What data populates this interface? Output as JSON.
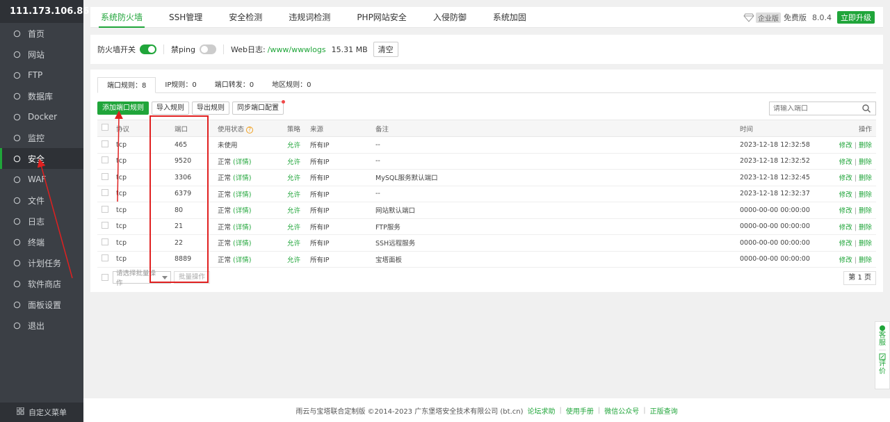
{
  "sidebar": {
    "ip": "111.173.106.86",
    "badge": "0",
    "items": [
      {
        "label": "首页"
      },
      {
        "label": "网站"
      },
      {
        "label": "FTP"
      },
      {
        "label": "数据库"
      },
      {
        "label": "Docker"
      },
      {
        "label": "监控"
      },
      {
        "label": "安全"
      },
      {
        "label": "WAF"
      },
      {
        "label": "文件"
      },
      {
        "label": "日志"
      },
      {
        "label": "终端"
      },
      {
        "label": "计划任务"
      },
      {
        "label": "软件商店"
      },
      {
        "label": "面板设置"
      },
      {
        "label": "退出"
      }
    ],
    "footer": "自定义菜单"
  },
  "topbar": {
    "tabs": [
      "系统防火墙",
      "SSH管理",
      "安全检测",
      "违规词检测",
      "PHP网站安全",
      "入侵防御",
      "系统加固"
    ],
    "edition": "企业版",
    "free": "免费版",
    "version": "8.0.4",
    "upgrade": "立即升级"
  },
  "firewall": {
    "switch_label": "防火墙开关",
    "ping_label": "禁ping",
    "weblog_label": "Web日志:",
    "weblog_path": "/www/wwwlogs",
    "weblog_size": "15.31 MB",
    "clear": "清空"
  },
  "subtabs": [
    "端口规则：8",
    "IP规则：0",
    "端口转发：0",
    "地区规则：0"
  ],
  "actions": {
    "add": "添加端口规则",
    "import": "导入规则",
    "export": "导出规则",
    "sync": "同步端口配置"
  },
  "search": {
    "placeholder": "请输入端口"
  },
  "table": {
    "headers": {
      "proto": "协议",
      "port": "端口",
      "status": "使用状态",
      "policy": "策略",
      "source": "来源",
      "note": "备注",
      "time": "时间",
      "op": "操作"
    },
    "rows": [
      {
        "proto": "tcp",
        "port": "465",
        "status": "未使用",
        "detail": "",
        "policy": "允许",
        "source": "所有IP",
        "note": "--",
        "time": "2023-12-18 12:32:58"
      },
      {
        "proto": "tcp",
        "port": "9520",
        "status": "正常",
        "detail": "(详情)",
        "policy": "允许",
        "source": "所有IP",
        "note": "--",
        "time": "2023-12-18 12:32:52"
      },
      {
        "proto": "tcp",
        "port": "3306",
        "status": "正常",
        "detail": "(详情)",
        "policy": "允许",
        "source": "所有IP",
        "note": "MySQL服务默认端口",
        "time": "2023-12-18 12:32:45"
      },
      {
        "proto": "tcp",
        "port": "6379",
        "status": "正常",
        "detail": "(详情)",
        "policy": "允许",
        "source": "所有IP",
        "note": "--",
        "time": "2023-12-18 12:32:37"
      },
      {
        "proto": "tcp",
        "port": "80",
        "status": "正常",
        "detail": "(详情)",
        "policy": "允许",
        "source": "所有IP",
        "note": "网站默认端口",
        "time": "0000-00-00 00:00:00"
      },
      {
        "proto": "tcp",
        "port": "21",
        "status": "正常",
        "detail": "(详情)",
        "policy": "允许",
        "source": "所有IP",
        "note": "FTP服务",
        "time": "0000-00-00 00:00:00"
      },
      {
        "proto": "tcp",
        "port": "22",
        "status": "正常",
        "detail": "(详情)",
        "policy": "允许",
        "source": "所有IP",
        "note": "SSH远程服务",
        "time": "0000-00-00 00:00:00"
      },
      {
        "proto": "tcp",
        "port": "8889",
        "status": "正常",
        "detail": "(详情)",
        "policy": "允许",
        "source": "所有IP",
        "note": "宝塔面板",
        "time": "0000-00-00 00:00:00"
      }
    ],
    "op_edit": "修改",
    "op_delete": "删除",
    "op_sep": "|"
  },
  "batch": {
    "placeholder": "请选择批量操作",
    "button": "批量操作"
  },
  "pager": "第 1 页",
  "footer": {
    "copyright": "雨云与宝塔联合定制版 ©2014-2023 广东堡塔安全技术有限公司 (bt.cn)",
    "links": [
      "论坛求助",
      "使用手册",
      "微信公众号",
      "正版查询"
    ],
    "sep": "|"
  },
  "float": {
    "service": [
      "客",
      "服"
    ],
    "review": [
      "评",
      "价"
    ]
  },
  "colors": {
    "accent": "#20a53a",
    "sidebar": "#3b3f45",
    "annotation": "#e02020"
  }
}
